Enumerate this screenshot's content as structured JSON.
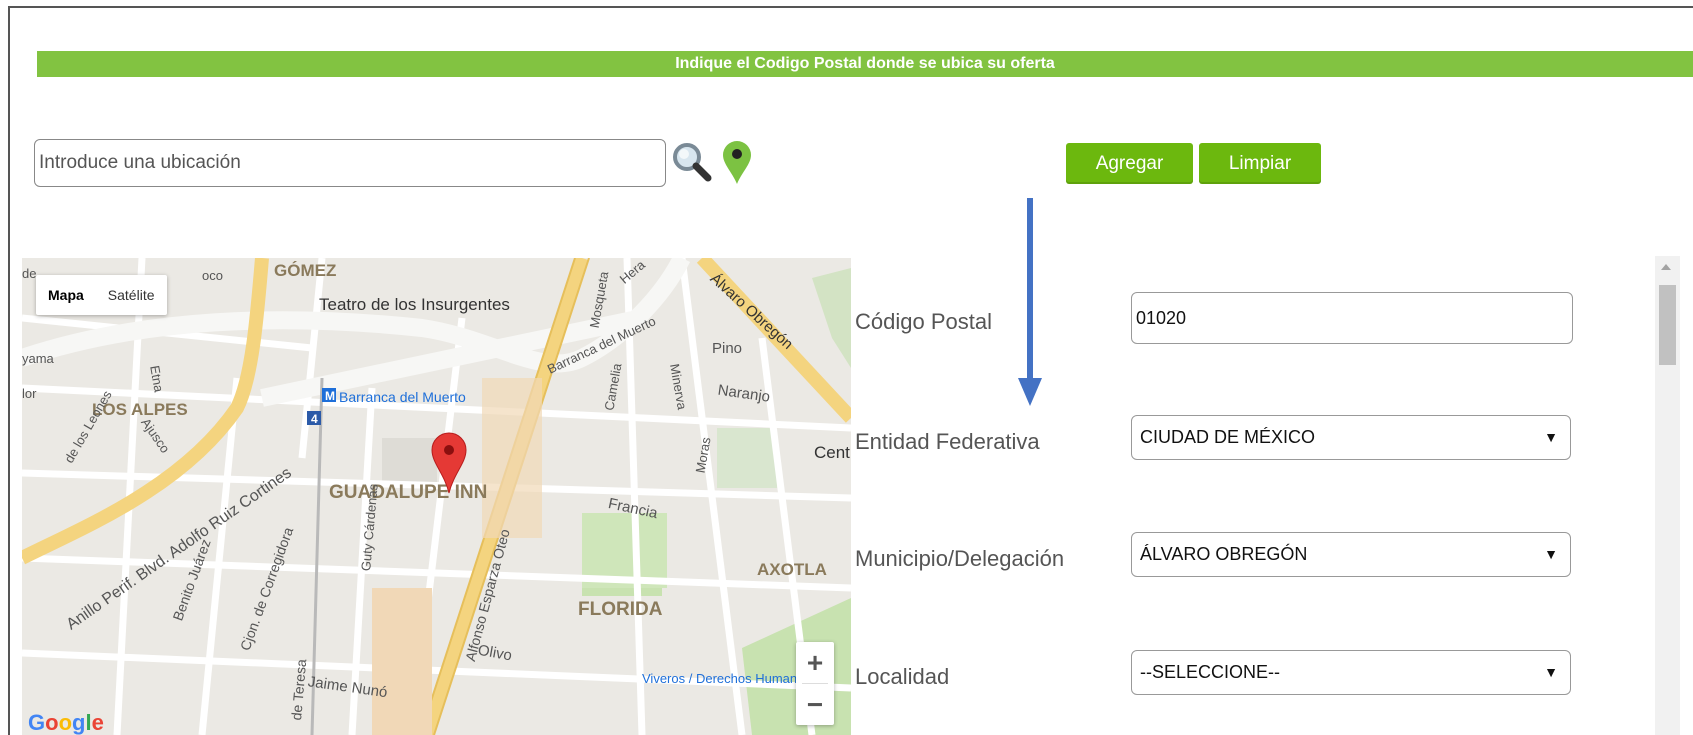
{
  "header": {
    "banner_text": "Indique el Codigo Postal donde se ubica su oferta"
  },
  "search": {
    "placeholder": "Introduce una ubicación",
    "value": ""
  },
  "buttons": {
    "add": "Agregar",
    "clear": "Limpiar"
  },
  "map": {
    "map_type_options": [
      "Mapa",
      "Satélite"
    ],
    "selected_map_type": "Mapa",
    "zoom_in": "+",
    "zoom_out": "−",
    "attribution": "Google",
    "labels": [
      "GÓMEZ",
      "Teatro de los Insurgentes",
      "Mosqueta",
      "Hera",
      "Álvaro Obregón",
      "Pino",
      "Barranca del Muerto",
      "Minerva",
      "Camelia",
      "Naranjo",
      "Etna",
      "LOS ALPES",
      "Ajusco",
      "Barranca del Muerto",
      "4",
      "Cent",
      "Moras",
      "GUADALUPE INN",
      "Francia",
      "Guty Cárdenas",
      "Anillo Perif. Blvd. Adolfo Ruiz Cortines",
      "Benito Juárez",
      "Cjon. de Corregidora",
      "Alfonso Esparza Oteo",
      "AXOTLA",
      "FLORIDA",
      "Olivo",
      "Jaime Nunó",
      "de Teresa",
      "Viveros / Derechos Humanos",
      "de los Leones",
      "yama",
      "lor",
      "de",
      "oco"
    ]
  },
  "form": {
    "postal_code": {
      "label": "Código Postal",
      "value": "01020"
    },
    "state": {
      "label": "Entidad Federativa",
      "value": "CIUDAD DE MÉXICO"
    },
    "municipality": {
      "label": "Municipio/Delegación",
      "value": "ÁLVARO OBREGÓN"
    },
    "locality": {
      "label": "Localidad",
      "value": "--SELECCIONE--"
    }
  },
  "colors": {
    "banner": "#82c341",
    "button": "#6cb80e",
    "arrow": "#4472c4",
    "marker": "#e53935"
  }
}
